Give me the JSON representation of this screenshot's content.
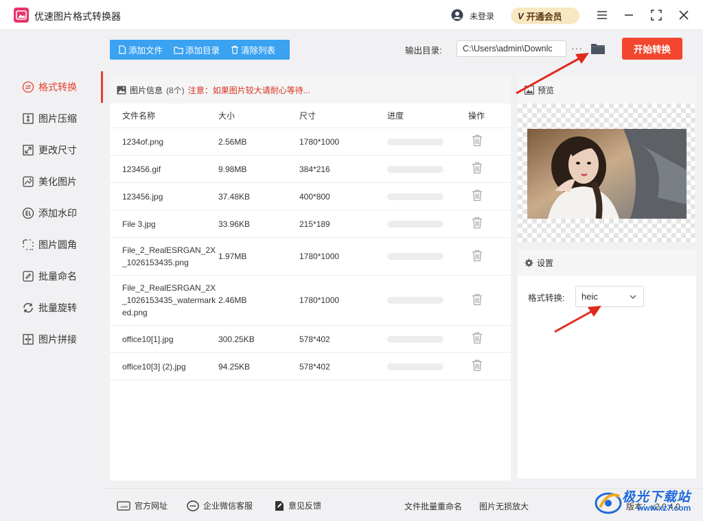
{
  "app": {
    "title": "优速图片格式转换器"
  },
  "header": {
    "user_label": "未登录",
    "vip_mark": "V",
    "vip_label": "开通会员"
  },
  "toolbar": {
    "add_file": "添加文件",
    "add_dir": "添加目录",
    "clear_list": "清除列表",
    "output_label": "输出目录:",
    "output_path": "C:\\Users\\admin\\Downlc",
    "more": "···",
    "start": "开始转换"
  },
  "sidebar": {
    "items": [
      {
        "label": "格式转换",
        "icon": "format-convert-icon"
      },
      {
        "label": "图片压缩",
        "icon": "compress-icon"
      },
      {
        "label": "更改尺寸",
        "icon": "resize-icon"
      },
      {
        "label": "美化图片",
        "icon": "beautify-icon"
      },
      {
        "label": "添加水印",
        "icon": "watermark-icon"
      },
      {
        "label": "图片圆角",
        "icon": "round-corner-icon"
      },
      {
        "label": "批量命名",
        "icon": "rename-icon"
      },
      {
        "label": "批量旋转",
        "icon": "rotate-icon"
      },
      {
        "label": "图片拼接",
        "icon": "splice-icon"
      }
    ]
  },
  "file_panel": {
    "title": "图片信息",
    "count": "(8个)",
    "notice": "注意：如果图片较大请耐心等待...",
    "columns": {
      "name": "文件名称",
      "size": "大小",
      "dim": "尺寸",
      "progress": "进度",
      "op": "操作"
    },
    "rows": [
      {
        "name": "1234of.png",
        "size": "2.56MB",
        "dim": "1780*1000",
        "progress": 0
      },
      {
        "name": "123456.gif",
        "size": "9.98MB",
        "dim": "384*216",
        "progress": 0
      },
      {
        "name": "123456.jpg",
        "size": "37.48KB",
        "dim": "400*800",
        "progress": 0
      },
      {
        "name": "File 3.jpg",
        "size": "33.96KB",
        "dim": "215*189",
        "progress": 0
      },
      {
        "name": "File_2_RealESRGAN_2X_1026153435.png",
        "size": "1.97MB",
        "dim": "1780*1000",
        "progress": 0
      },
      {
        "name": "File_2_RealESRGAN_2X_1026153435_watermarked.png",
        "size": "2.46MB",
        "dim": "1780*1000",
        "progress": 0
      },
      {
        "name": "office10[1].jpg",
        "size": "300.25KB",
        "dim": "578*402",
        "progress": 0
      },
      {
        "name": "office10[3] (2).jpg",
        "size": "94.25KB",
        "dim": "578*402",
        "progress": 0
      }
    ]
  },
  "preview": {
    "title": "预览"
  },
  "settings": {
    "title": "设置",
    "format_label": "格式转换:",
    "format_value": "heic"
  },
  "footer": {
    "website": "官方网址",
    "wechat": "企业微信客服",
    "feedback": "意见反馈",
    "batch_rename": "文件批量重命名",
    "lossless": "图片无损放大",
    "version": "版本：v2.0.4.0"
  },
  "watermark": {
    "line1": "极光下载站",
    "line2": "www.xz7.com"
  },
  "colors": {
    "accent": "#e63f2c",
    "toolbar_blue": "#3aa2f1",
    "start_red": "#f2462e",
    "vip_gold": "#f9e7c2"
  }
}
